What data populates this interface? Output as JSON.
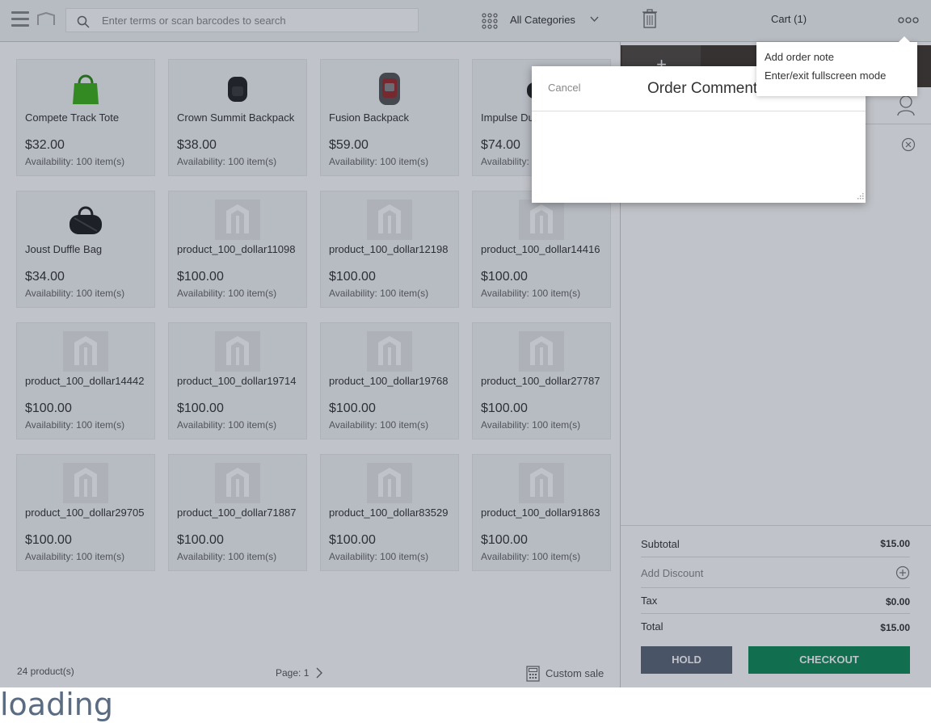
{
  "search": {
    "placeholder": "Enter terms or scan barcodes to search"
  },
  "category_select": {
    "selected": "All Categories"
  },
  "products": [
    {
      "name": "Compete Track Tote",
      "price": "$32.00",
      "availability": "Availability: 100 item(s)",
      "image": "green-tote-bag"
    },
    {
      "name": "Crown Summit Backpack",
      "price": "$38.00",
      "availability": "Availability: 100 item(s)",
      "image": "black-backpack"
    },
    {
      "name": "Fusion Backpack",
      "price": "$59.00",
      "availability": "Availability: 100 item(s)",
      "image": "red-grey-backpack"
    },
    {
      "name": "Impulse Duffle",
      "price": "$74.00",
      "availability": "Availability: 100 item(s)",
      "image": "black-duffle"
    },
    {
      "name": "Joust Duffle Bag",
      "price": "$34.00",
      "availability": "Availability: 100 item(s)",
      "image": "black-duffle-bag"
    },
    {
      "name": "product_100_dollar11098",
      "price": "$100.00",
      "availability": "Availability: 100 item(s)",
      "image": "placeholder-logo"
    },
    {
      "name": "product_100_dollar12198",
      "price": "$100.00",
      "availability": "Availability: 100 item(s)",
      "image": "placeholder-logo"
    },
    {
      "name": "product_100_dollar14416",
      "price": "$100.00",
      "availability": "Availability: 100 item(s)",
      "image": "placeholder-logo"
    },
    {
      "name": "product_100_dollar14442",
      "price": "$100.00",
      "availability": "Availability: 100 item(s)",
      "image": "placeholder-logo"
    },
    {
      "name": "product_100_dollar19714",
      "price": "$100.00",
      "availability": "Availability: 100 item(s)",
      "image": "placeholder-logo"
    },
    {
      "name": "product_100_dollar19768",
      "price": "$100.00",
      "availability": "Availability: 100 item(s)",
      "image": "placeholder-logo"
    },
    {
      "name": "product_100_dollar27787",
      "price": "$100.00",
      "availability": "Availability: 100 item(s)",
      "image": "placeholder-logo"
    },
    {
      "name": "product_100_dollar29705",
      "price": "$100.00",
      "availability": "Availability: 100 item(s)",
      "image": "placeholder-logo"
    },
    {
      "name": "product_100_dollar71887",
      "price": "$100.00",
      "availability": "Availability: 100 item(s)",
      "image": "placeholder-logo"
    },
    {
      "name": "product_100_dollar83529",
      "price": "$100.00",
      "availability": "Availability: 100 item(s)",
      "image": "placeholder-logo"
    },
    {
      "name": "product_100_dollar91863",
      "price": "$100.00",
      "availability": "Availability: 100 item(s)",
      "image": "placeholder-logo"
    }
  ],
  "footer": {
    "product_count": "24 product(s)",
    "page": "Page: 1",
    "custom_sale": "Custom sale"
  },
  "cart": {
    "title": "Cart (1)",
    "add_tab": "+",
    "subtotal_label": "Subtotal",
    "subtotal_value": "$15.00",
    "discount_label": "Add Discount",
    "tax_label": "Tax",
    "tax_value": "$0.00",
    "total_label": "Total",
    "total_value": "$15.00",
    "hold_label": "HOLD",
    "checkout_label": "CHECKOUT"
  },
  "dialog": {
    "cancel_label": "Cancel",
    "title": "Order Comment"
  },
  "more_menu": {
    "items": [
      "Add order note",
      "Enter/exit fullscreen mode"
    ]
  },
  "loading_text": "loading",
  "colors": {
    "hold": "#5c6678",
    "checkout": "#0d8a55",
    "cart_bar": "#41362f",
    "loading": "#5a6b82"
  }
}
